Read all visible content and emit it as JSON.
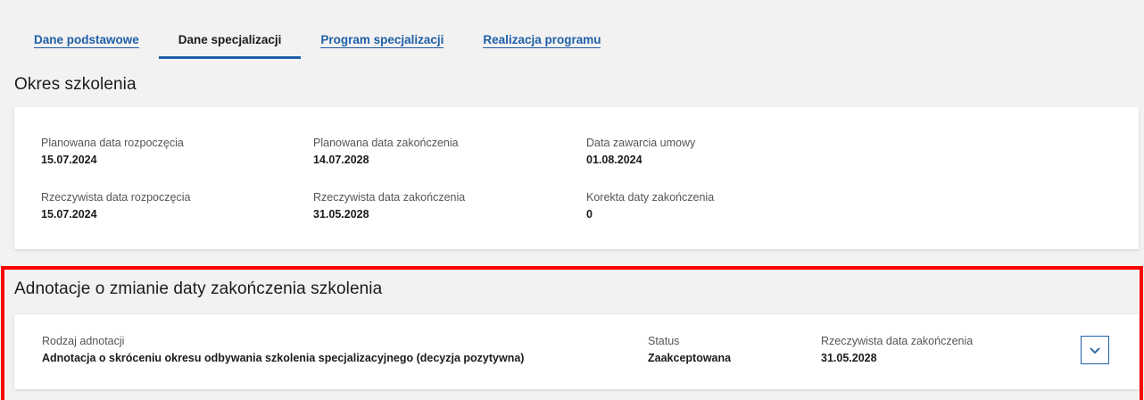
{
  "tabs": [
    {
      "label": "Dane podstawowe",
      "active": false
    },
    {
      "label": "Dane specjalizacji",
      "active": true
    },
    {
      "label": "Program specjalizacji",
      "active": false
    },
    {
      "label": "Realizacja programu",
      "active": false
    }
  ],
  "okres": {
    "title": "Okres szkolenia",
    "fields": [
      {
        "label": "Planowana data rozpoczęcia",
        "value": "15.07.2024"
      },
      {
        "label": "Planowana data zakończenia",
        "value": "14.07.2028"
      },
      {
        "label": "Data zawarcia umowy",
        "value": "01.08.2024"
      },
      {
        "label": "Rzeczywista data rozpoczęcia",
        "value": "15.07.2024"
      },
      {
        "label": "Rzeczywista data zakończenia",
        "value": "31.05.2028"
      },
      {
        "label": "Korekta daty zakończenia",
        "value": "0"
      }
    ]
  },
  "adnotacje": {
    "title": "Adnotacje o zmianie daty zakończenia szkolenia",
    "items": [
      {
        "type_label": "Rodzaj adnotacji",
        "type_value": "Adnotacja o skróceniu okresu odbywania szkolenia specjalizacyjnego (decyzja pozytywna)",
        "status_label": "Status",
        "status_value": "Zaakceptowana",
        "date_label": "Rzeczywista data zakończenia",
        "date_value": "31.05.2028",
        "expand_icon": "chevron-down-icon"
      }
    ]
  },
  "colors": {
    "accent": "#1f5fa8",
    "highlight": "#ff0000",
    "background": "#f2f2f2"
  }
}
